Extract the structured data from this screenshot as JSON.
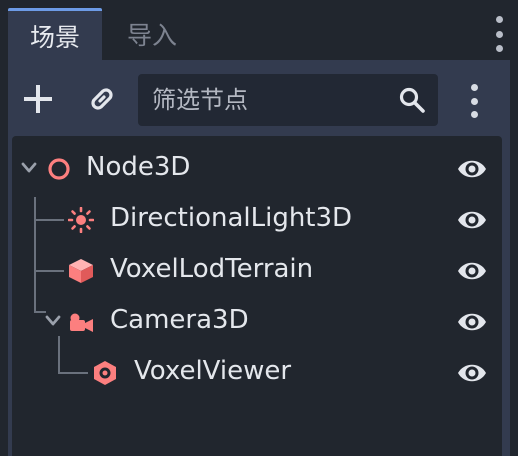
{
  "tabs": [
    {
      "label": "场景",
      "active": true
    },
    {
      "label": "导入",
      "active": false
    }
  ],
  "toolbar": {
    "add_icon": "plus-icon",
    "link_icon": "link-icon",
    "filter_placeholder": "筛选节点",
    "search_icon": "search-icon",
    "menu_icon": "kebab-menu-icon"
  },
  "tree": [
    {
      "label": "Node3D",
      "icon": "node3d-icon",
      "expanded": true,
      "visible": true
    },
    {
      "label": "DirectionalLight3D",
      "icon": "directional-light-icon",
      "visible": true
    },
    {
      "label": "VoxelLodTerrain",
      "icon": "voxel-lod-terrain-icon",
      "visible": true
    },
    {
      "label": "Camera3D",
      "icon": "camera-icon",
      "expanded": true,
      "visible": true
    },
    {
      "label": "VoxelViewer",
      "icon": "voxel-viewer-icon",
      "visible": true
    }
  ],
  "colors": {
    "accent": "#6d9be6",
    "node_icon": "#fc7f7f",
    "panel_bg": "#333b4f",
    "tree_bg": "#21262e"
  }
}
